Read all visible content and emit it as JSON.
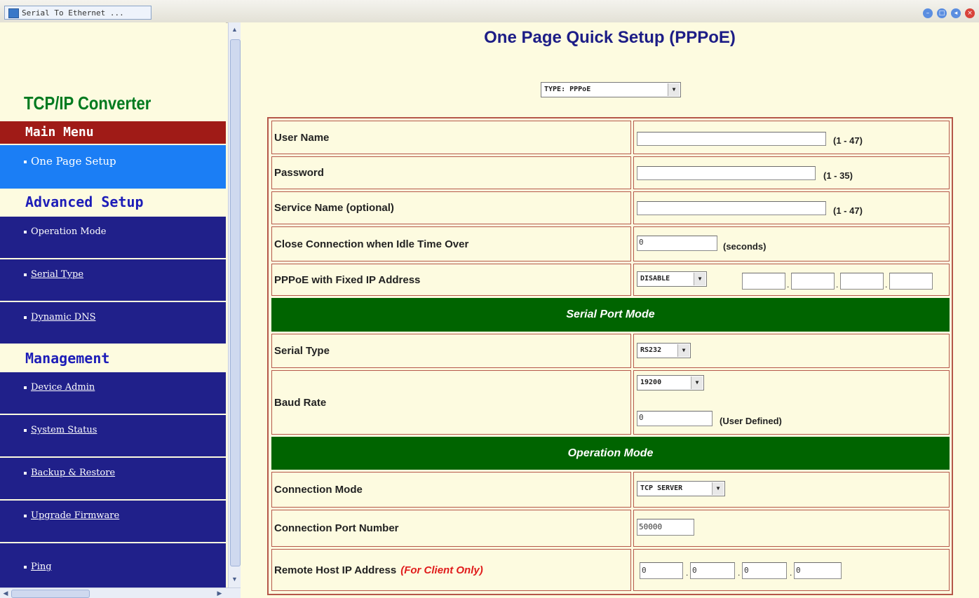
{
  "browser": {
    "tab_title": "Serial To Ethernet ..."
  },
  "sidebar": {
    "brand": "TCP/IP Converter",
    "main_menu": "Main Menu",
    "advanced_setup": "Advanced Setup",
    "management": "Management",
    "items": [
      {
        "label": "One Page Setup"
      },
      {
        "label": "Operation Mode"
      },
      {
        "label": "Serial Type"
      },
      {
        "label": "Dynamic DNS"
      },
      {
        "label": "Device Admin"
      },
      {
        "label": "System Status"
      },
      {
        "label": "Backup & Restore"
      },
      {
        "label": "Upgrade Firmware"
      },
      {
        "label": "Ping"
      }
    ]
  },
  "page": {
    "title": "One Page Quick Setup (PPPoE)",
    "type_select": "TYPE: PPPoE"
  },
  "form": {
    "user_name": {
      "label": "User Name",
      "value": "",
      "hint": "(1 - 47)"
    },
    "password": {
      "label": "Password",
      "value": "",
      "hint": "(1 - 35)"
    },
    "service_name": {
      "label": "Service Name (optional)",
      "value": "",
      "hint": "(1 - 47)"
    },
    "idle_time": {
      "label": "Close Connection when Idle Time Over",
      "value": "0",
      "hint": "(seconds)"
    },
    "fixed_ip": {
      "label": "PPPoE with Fixed IP Address",
      "select": "DISABLE",
      "octets": [
        "",
        "",
        "",
        ""
      ]
    },
    "serial_section": "Serial Port Mode",
    "serial_type": {
      "label": "Serial Type",
      "select": "RS232"
    },
    "baud_rate": {
      "label": "Baud Rate",
      "select": "19200",
      "custom_value": "0",
      "hint": "(User Defined)"
    },
    "operation_section": "Operation Mode",
    "connection_mode": {
      "label": "Connection Mode",
      "select": "TCP SERVER"
    },
    "port_number": {
      "label": "Connection Port Number",
      "value": "50000"
    },
    "remote_host": {
      "label": "Remote Host  IP Address",
      "note": "(For Client Only)",
      "octets": [
        "0",
        "0",
        "0",
        "0"
      ]
    }
  }
}
